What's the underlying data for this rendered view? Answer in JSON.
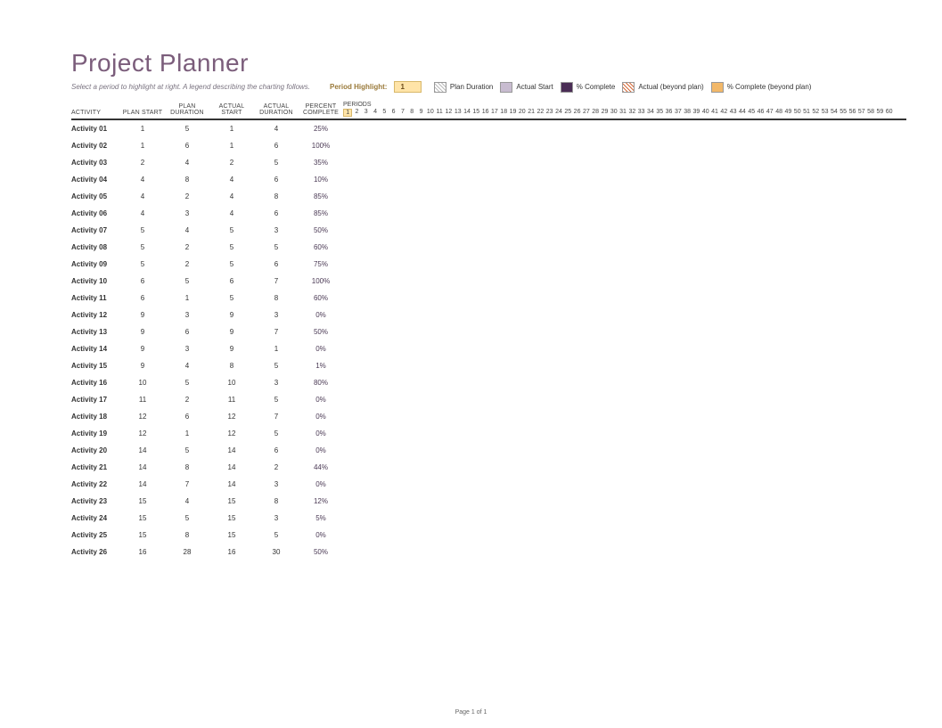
{
  "title": "Project Planner",
  "subtitle": "Select a period to highlight at right. A legend describing the charting follows.",
  "period_highlight_label": "Period Highlight:",
  "period_highlight_value": "1",
  "legend": {
    "plan_duration": "Plan Duration",
    "actual_start": "Actual Start",
    "pct_complete": "% Complete",
    "actual_beyond": "Actual (beyond plan)",
    "pct_complete_beyond": "% Complete (beyond plan)"
  },
  "columns": {
    "activity": "ACTIVITY",
    "plan_start": "PLAN START",
    "plan_duration": "PLAN DURATION",
    "actual_start": "ACTUAL START",
    "actual_duration": "ACTUAL DURATION",
    "percent_complete": "PERCENT COMPLETE",
    "periods": "PERIODS"
  },
  "periods_count": 60,
  "highlighted_period": 1,
  "rows": [
    {
      "activity": "Activity 01",
      "plan_start": "1",
      "plan_duration": "5",
      "actual_start": "1",
      "actual_duration": "4",
      "pct": "25%"
    },
    {
      "activity": "Activity 02",
      "plan_start": "1",
      "plan_duration": "6",
      "actual_start": "1",
      "actual_duration": "6",
      "pct": "100%"
    },
    {
      "activity": "Activity 03",
      "plan_start": "2",
      "plan_duration": "4",
      "actual_start": "2",
      "actual_duration": "5",
      "pct": "35%"
    },
    {
      "activity": "Activity 04",
      "plan_start": "4",
      "plan_duration": "8",
      "actual_start": "4",
      "actual_duration": "6",
      "pct": "10%"
    },
    {
      "activity": "Activity 05",
      "plan_start": "4",
      "plan_duration": "2",
      "actual_start": "4",
      "actual_duration": "8",
      "pct": "85%"
    },
    {
      "activity": "Activity 06",
      "plan_start": "4",
      "plan_duration": "3",
      "actual_start": "4",
      "actual_duration": "6",
      "pct": "85%"
    },
    {
      "activity": "Activity 07",
      "plan_start": "5",
      "plan_duration": "4",
      "actual_start": "5",
      "actual_duration": "3",
      "pct": "50%"
    },
    {
      "activity": "Activity 08",
      "plan_start": "5",
      "plan_duration": "2",
      "actual_start": "5",
      "actual_duration": "5",
      "pct": "60%"
    },
    {
      "activity": "Activity 09",
      "plan_start": "5",
      "plan_duration": "2",
      "actual_start": "5",
      "actual_duration": "6",
      "pct": "75%"
    },
    {
      "activity": "Activity 10",
      "plan_start": "6",
      "plan_duration": "5",
      "actual_start": "6",
      "actual_duration": "7",
      "pct": "100%"
    },
    {
      "activity": "Activity 11",
      "plan_start": "6",
      "plan_duration": "1",
      "actual_start": "5",
      "actual_duration": "8",
      "pct": "60%"
    },
    {
      "activity": "Activity 12",
      "plan_start": "9",
      "plan_duration": "3",
      "actual_start": "9",
      "actual_duration": "3",
      "pct": "0%"
    },
    {
      "activity": "Activity 13",
      "plan_start": "9",
      "plan_duration": "6",
      "actual_start": "9",
      "actual_duration": "7",
      "pct": "50%"
    },
    {
      "activity": "Activity 14",
      "plan_start": "9",
      "plan_duration": "3",
      "actual_start": "9",
      "actual_duration": "1",
      "pct": "0%"
    },
    {
      "activity": "Activity 15",
      "plan_start": "9",
      "plan_duration": "4",
      "actual_start": "8",
      "actual_duration": "5",
      "pct": "1%"
    },
    {
      "activity": "Activity 16",
      "plan_start": "10",
      "plan_duration": "5",
      "actual_start": "10",
      "actual_duration": "3",
      "pct": "80%"
    },
    {
      "activity": "Activity 17",
      "plan_start": "11",
      "plan_duration": "2",
      "actual_start": "11",
      "actual_duration": "5",
      "pct": "0%"
    },
    {
      "activity": "Activity 18",
      "plan_start": "12",
      "plan_duration": "6",
      "actual_start": "12",
      "actual_duration": "7",
      "pct": "0%"
    },
    {
      "activity": "Activity 19",
      "plan_start": "12",
      "plan_duration": "1",
      "actual_start": "12",
      "actual_duration": "5",
      "pct": "0%"
    },
    {
      "activity": "Activity 20",
      "plan_start": "14",
      "plan_duration": "5",
      "actual_start": "14",
      "actual_duration": "6",
      "pct": "0%"
    },
    {
      "activity": "Activity 21",
      "plan_start": "14",
      "plan_duration": "8",
      "actual_start": "14",
      "actual_duration": "2",
      "pct": "44%"
    },
    {
      "activity": "Activity 22",
      "plan_start": "14",
      "plan_duration": "7",
      "actual_start": "14",
      "actual_duration": "3",
      "pct": "0%"
    },
    {
      "activity": "Activity 23",
      "plan_start": "15",
      "plan_duration": "4",
      "actual_start": "15",
      "actual_duration": "8",
      "pct": "12%"
    },
    {
      "activity": "Activity 24",
      "plan_start": "15",
      "plan_duration": "5",
      "actual_start": "15",
      "actual_duration": "3",
      "pct": "5%"
    },
    {
      "activity": "Activity 25",
      "plan_start": "15",
      "plan_duration": "8",
      "actual_start": "15",
      "actual_duration": "5",
      "pct": "0%"
    },
    {
      "activity": "Activity 26",
      "plan_start": "16",
      "plan_duration": "28",
      "actual_start": "16",
      "actual_duration": "30",
      "pct": "50%"
    }
  ],
  "footer": "Page 1 of 1"
}
